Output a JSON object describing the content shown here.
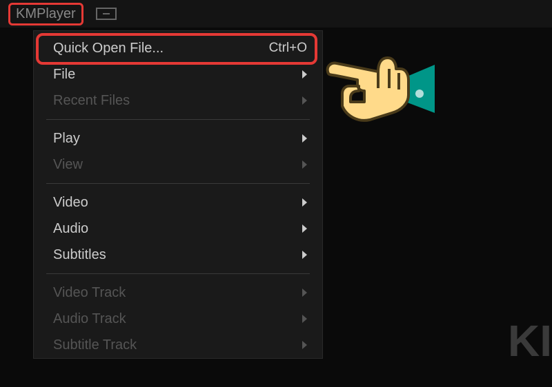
{
  "titlebar": {
    "app_name": "KMPlayer"
  },
  "menu": {
    "items": [
      {
        "label": "Quick Open File...",
        "shortcut": "Ctrl+O",
        "enabled": true,
        "submenu": false
      },
      {
        "label": "File",
        "enabled": true,
        "submenu": true
      },
      {
        "label": "Recent Files",
        "enabled": false,
        "submenu": true
      },
      {
        "sep": true
      },
      {
        "label": "Play",
        "enabled": true,
        "submenu": true
      },
      {
        "label": "View",
        "enabled": false,
        "submenu": true
      },
      {
        "sep": true
      },
      {
        "label": "Video",
        "enabled": true,
        "submenu": true
      },
      {
        "label": "Audio",
        "enabled": true,
        "submenu": true
      },
      {
        "label": "Subtitles",
        "enabled": true,
        "submenu": true
      },
      {
        "sep": true
      },
      {
        "label": "Video Track",
        "enabled": false,
        "submenu": true
      },
      {
        "label": "Audio Track",
        "enabled": false,
        "submenu": true
      },
      {
        "label": "Subtitle Track",
        "enabled": false,
        "submenu": true
      }
    ]
  },
  "watermark": "KI",
  "annotations": {
    "highlight_targets": [
      "app-title",
      "menu-quick-open-file"
    ],
    "pointer_hand": true
  },
  "colors": {
    "highlight": "#e53935",
    "hand_cuff": "#009688",
    "hand_skin": "#ffda8a"
  }
}
